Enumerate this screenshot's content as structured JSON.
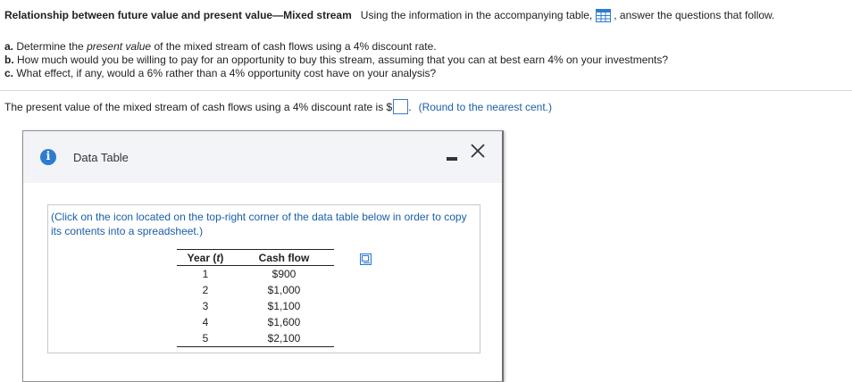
{
  "header": {
    "title": "Relationship between future value and present value—Mixed stream",
    "intro": "Using the information in the accompanying table,",
    "outro": ", answer the questions that follow."
  },
  "questions": [
    {
      "letter": "a.",
      "pre": "Determine the ",
      "italic": "present value",
      "post": " of the mixed stream of cash flows using a 4% discount rate."
    },
    {
      "letter": "b.",
      "pre": "How much would you be willing to pay for an opportunity to buy this stream, assuming that you can at best earn 4% on your investments?",
      "italic": "",
      "post": ""
    },
    {
      "letter": "c.",
      "pre": "What effect, if any, would a 6% rather than a 4% opportunity cost have on your analysis?",
      "italic": "",
      "post": ""
    }
  ],
  "answer": {
    "prompt": "The present value of the mixed stream of cash flows using a 4% discount rate is $",
    "value": "",
    "after": ".",
    "hint": "(Round to the nearest cent.)"
  },
  "dialog": {
    "info_icon": "i",
    "title": "Data Table",
    "instructions": "(Click on the icon located on the top-right corner of the data table below in order to copy its contents into a spreadsheet.)",
    "table": {
      "col_year_pre": "Year (",
      "col_year_var": "t",
      "col_year_post": ")",
      "col_cash": "Cash flow",
      "rows": [
        {
          "year": "1",
          "cash": "$900"
        },
        {
          "year": "2",
          "cash": "$1,000"
        },
        {
          "year": "3",
          "cash": "$1,100"
        },
        {
          "year": "4",
          "cash": "$1,600"
        },
        {
          "year": "5",
          "cash": "$2,100"
        }
      ]
    }
  },
  "colors": {
    "accent": "#2e7bcf",
    "link": "#1a5ea8"
  }
}
